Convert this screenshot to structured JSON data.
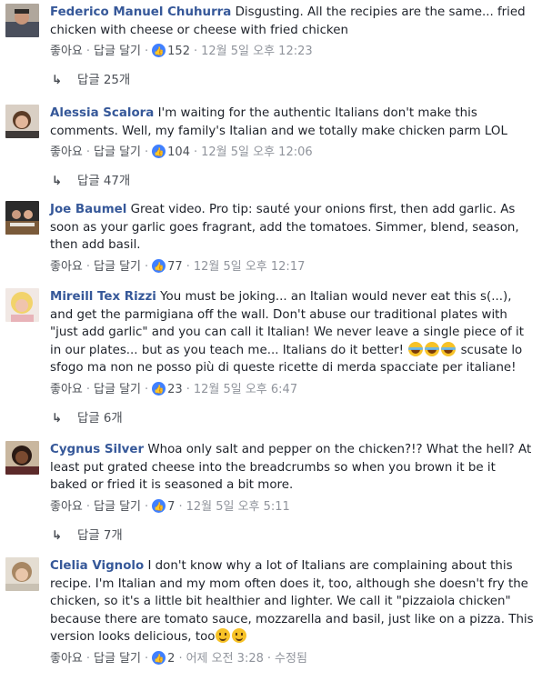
{
  "comments": [
    {
      "author": "Federico Manuel Chuhurra",
      "text": "Disgusting. All the recipies are the same... fried chicken with cheese or cheese with fried chicken",
      "like_label": "좋아요",
      "reply_label": "답글 달기",
      "likes": "152",
      "time": "12월 5일 오후 12:23",
      "replies": "답글 25개"
    },
    {
      "author": "Alessia Scalora",
      "text": "I'm waiting for the authentic Italians don't make this comments. Well, my family's Italian and we totally make chicken parm LOL",
      "like_label": "좋아요",
      "reply_label": "답글 달기",
      "likes": "104",
      "time": "12월 5일 오후 12:06",
      "replies": "답글 47개"
    },
    {
      "author": "Joe Baumel",
      "text": "Great video. Pro tip: sauté your onions first, then add garlic. As soon as your garlic goes fragrant, add the tomatoes. Simmer, blend, season, then add basil.",
      "like_label": "좋아요",
      "reply_label": "답글 달기",
      "likes": "77",
      "time": "12월 5일 오후 12:17"
    },
    {
      "author": "Mireill Tex Rizzi",
      "text": "You must be joking... an Italian would never eat this s(...), and get the parmigiana off the wall. Don't abuse our traditional plates with \"just add garlic\" and you can call it Italian! We never leave a single piece of it in our plates... but as you teach me... Italians do it better!",
      "text_tail": "scusate lo sfogo ma non ne posso più di queste ricette di merda spacciate per italiane!",
      "emoji": "laughing-emoji",
      "like_label": "좋아요",
      "reply_label": "답글 달기",
      "likes": "23",
      "time": "12월 5일 오후 6:47",
      "replies": "답글 6개"
    },
    {
      "author": "Cygnus Silver",
      "text": "Whoa only salt and pepper on the chicken?!? What the hell? At least put grated cheese into the breadcrumbs so when you brown it be it baked or fried it is seasoned a bit more.",
      "like_label": "좋아요",
      "reply_label": "답글 달기",
      "likes": "7",
      "time": "12월 5일 오후 5:11",
      "replies": "답글 7개"
    },
    {
      "author": "Clelia Vignolo",
      "text": "I don't know why a lot of Italians are complaining about this recipe. I'm Italian and my mom often does it, too, although she doesn't fry the chicken, so it's a little bit healthier and lighter. We call it \"pizzaiola chicken\" because there are tomato sauce, mozzarella and basil, just like on a pizza. This version looks delicious, too",
      "emoji": "smiling-emoji",
      "like_label": "좋아요",
      "reply_label": "답글 달기",
      "likes": "2",
      "time": "어제 오전 3:28",
      "edited": "수정됨"
    }
  ],
  "colors": {
    "author": "#365899",
    "text": "#1d2129",
    "meta": "#90949c",
    "like_badge": "#4080ff"
  }
}
